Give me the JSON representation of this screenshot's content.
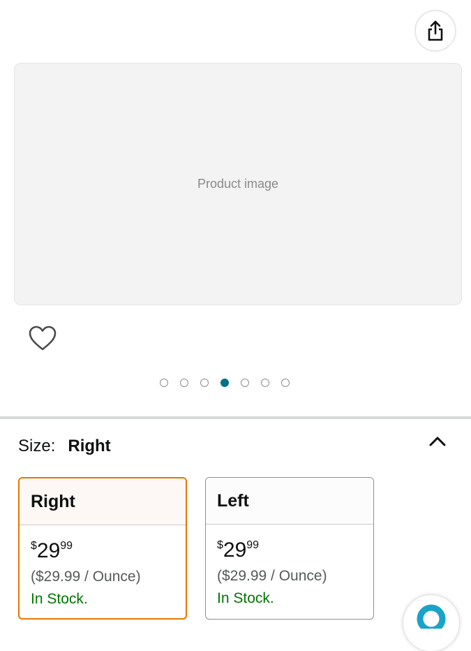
{
  "gallery": {
    "image_alt": "Product image",
    "dots_total": 7,
    "active_dot": 4
  },
  "size_selector": {
    "label": "Size:",
    "selected": "Right"
  },
  "variants": [
    {
      "name": "Right",
      "price_currency": "$",
      "price_whole": "29",
      "price_fraction": "99",
      "per_unit": "($29.99 / Ounce)",
      "stock": "In Stock."
    },
    {
      "name": "Left",
      "price_currency": "$",
      "price_whole": "29",
      "price_fraction": "99",
      "per_unit": "($29.99 / Ounce)",
      "stock": "In Stock."
    }
  ],
  "icons": {
    "share": "share-icon",
    "wishlist": "heart-icon",
    "collapse": "chevron-up-icon",
    "assistant": "assistant-icon"
  },
  "colors": {
    "selected_border": "#e77600",
    "active_dot": "#007185",
    "in_stock": "#007600",
    "assistant": "#1aa3c9"
  }
}
